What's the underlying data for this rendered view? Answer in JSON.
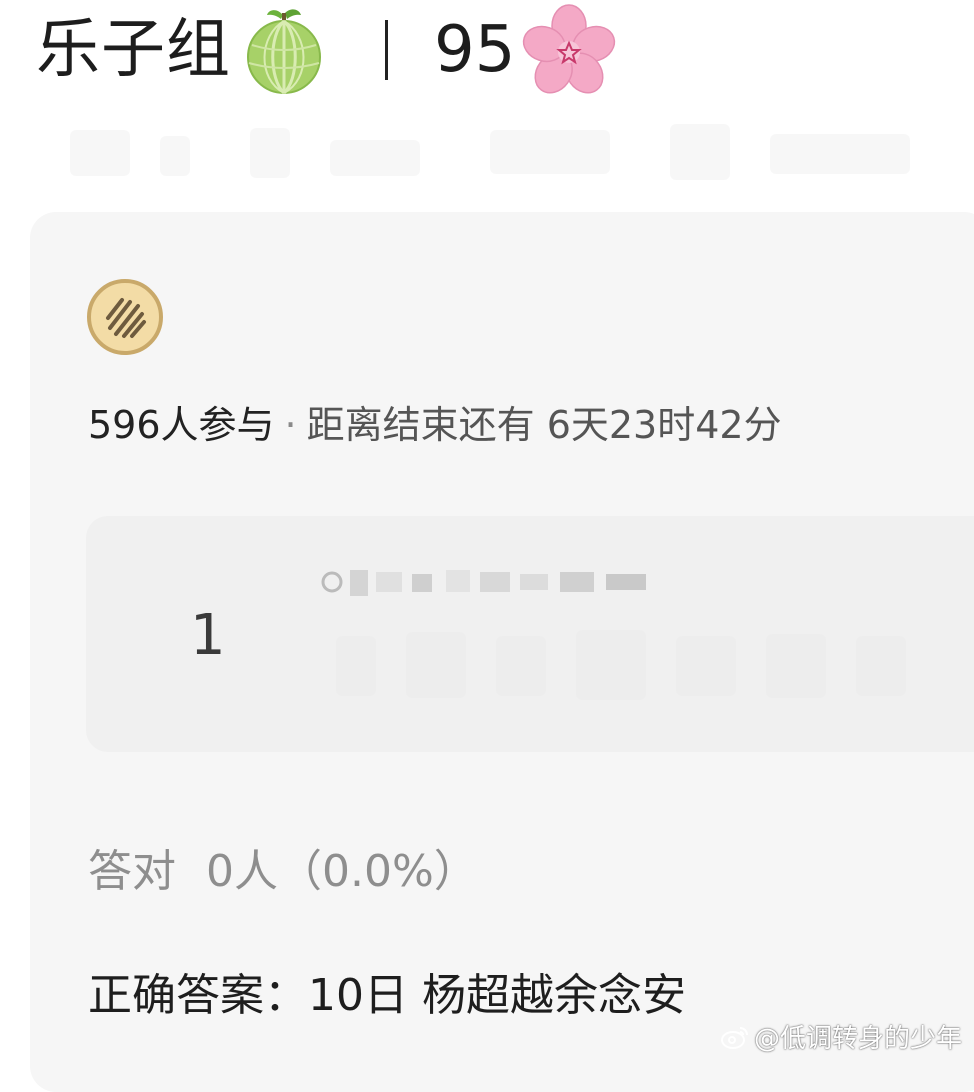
{
  "header": {
    "group_name": "乐子组",
    "group_icon": "melon-emoji",
    "score": "95",
    "score_icon": "cherry-blossom-emoji"
  },
  "quiz": {
    "avatar_icon": "biscuit-avatar",
    "participants": "596人参与",
    "separator": "·",
    "time_left": "距离结束还有 6天23时42分",
    "options": [
      {
        "index": "1"
      }
    ],
    "correct_stat_label": "答对",
    "correct_stat_value": "0人（0.0%）",
    "answer": "正确答案：10日 杨超越余念安"
  },
  "watermark": {
    "text": "@低调转身的少年",
    "icon": "weibo-icon"
  },
  "colors": {
    "card_bg": "#f6f6f6",
    "option_bg": "#f0f0f0",
    "muted_text": "#8e8e8e",
    "melon_green": "#9fce5b",
    "blossom_pink": "#f4a9c6"
  }
}
